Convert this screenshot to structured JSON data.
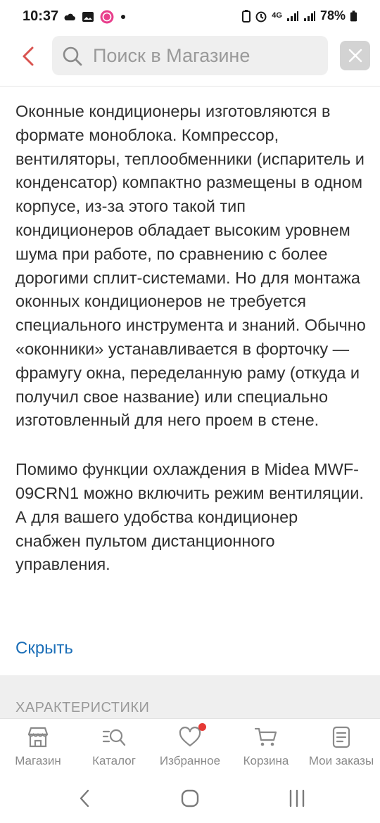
{
  "status_bar": {
    "time": "10:37",
    "network": "4G",
    "battery": "78%"
  },
  "header": {
    "search_placeholder": "Поиск в Магазине"
  },
  "description": {
    "paragraph1": "Оконные кондиционеры изготовляются в формате моноблока. Компрессор, вентиляторы, теплообменники (испаритель и конденсатор) компактно размещены в одном корпусе, из-за этого такой тип кондиционеров обладает высоким уровнем шума при работе, по сравнению с более дорогими сплит-системами. Но для монтажа оконных кондиционеров не требуется специального инструмента и знаний. Обычно «оконники» устанавливается в форточку — фрамугу окна, переделанную раму (откуда и получил свое название) или специально изготовленный для него проем в стене.",
    "paragraph2": "Помимо функции охлаждения в Midea MWF-09CRN1 можно включить режим вентиляции. А для вашего удобства кондиционер снабжен пультом дистанционного управления.",
    "hide_label": "Скрыть"
  },
  "characteristics": {
    "title": "ХАРАКТЕРИСТИКИ"
  },
  "bottom_nav": {
    "items": [
      {
        "label": "Магазин",
        "icon": "store-icon"
      },
      {
        "label": "Каталог",
        "icon": "catalog-search-icon"
      },
      {
        "label": "Избранное",
        "icon": "heart-icon",
        "has_badge": true
      },
      {
        "label": "Корзина",
        "icon": "cart-icon"
      },
      {
        "label": "Мои заказы",
        "icon": "orders-icon"
      }
    ]
  },
  "colors": {
    "accent_red": "#d9534f",
    "link_blue": "#1c6fb8",
    "badge_red": "#e53935"
  }
}
